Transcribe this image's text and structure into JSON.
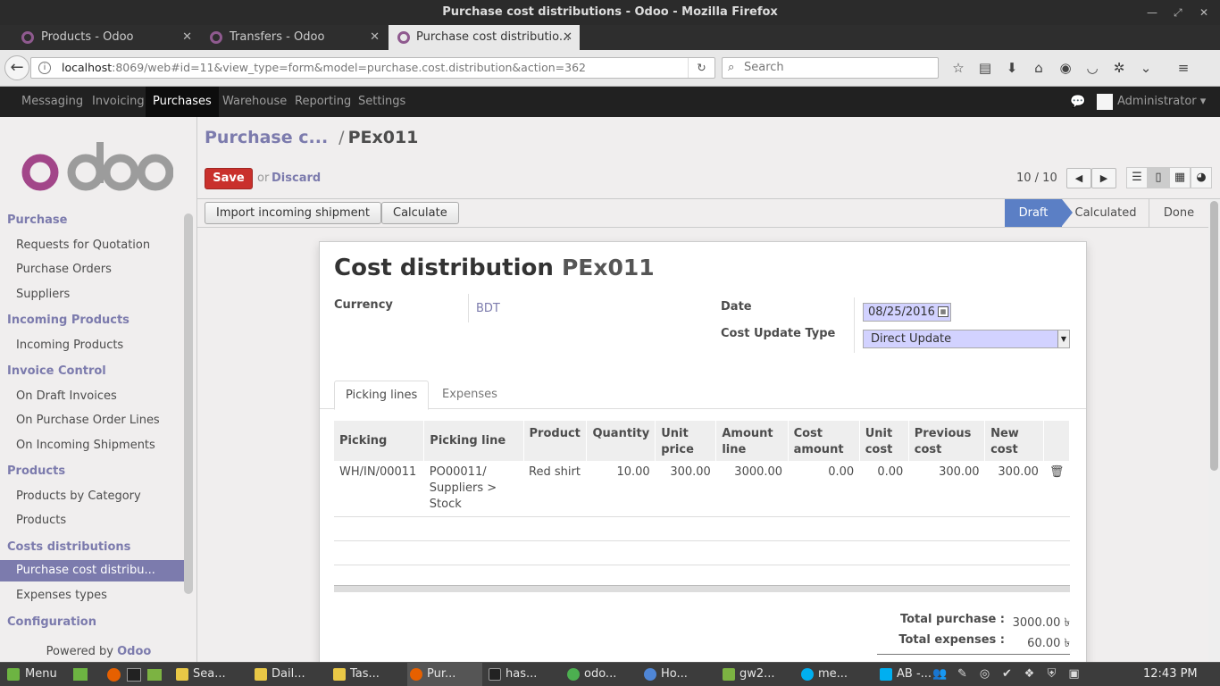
{
  "window": {
    "title": "Purchase cost distributions - Odoo - Mozilla Firefox"
  },
  "browser": {
    "tabs": [
      {
        "label": "Products - Odoo"
      },
      {
        "label": "Transfers - Odoo"
      },
      {
        "label": "Purchase cost distributio..."
      }
    ],
    "url_host": "localhost",
    "url_rest": ":8069/web#id=11&view_type=form&model=purchase.cost.distribution&action=362",
    "search_placeholder": "Search"
  },
  "topmenu": {
    "items": [
      "Messaging",
      "Invoicing",
      "Purchases",
      "Warehouse",
      "Reporting",
      "Settings"
    ],
    "active": "Purchases",
    "user": "Administrator"
  },
  "sidebar": {
    "sections": [
      {
        "title": "Purchase",
        "items": [
          "Requests for Quotation",
          "Purchase Orders",
          "Suppliers"
        ]
      },
      {
        "title": "Incoming Products",
        "items": [
          "Incoming Products"
        ]
      },
      {
        "title": "Invoice Control",
        "items": [
          "On Draft Invoices",
          "On Purchase Order Lines",
          "On Incoming Shipments"
        ]
      },
      {
        "title": "Products",
        "items": [
          "Products by Category",
          "Products"
        ]
      },
      {
        "title": "Costs distributions",
        "items": [
          "Purchase cost distribu...",
          "Expenses types"
        ]
      },
      {
        "title": "Configuration",
        "items": []
      }
    ],
    "powered_by": "Powered by",
    "powered_brand": "Odoo"
  },
  "control": {
    "breadcrumb_parent": "Purchase c...",
    "breadcrumb_sep": "/",
    "breadcrumb_current": "PEx011",
    "save_label": "Save",
    "or_label": "or",
    "discard_label": "Discard",
    "pager": "10 / 10"
  },
  "header": {
    "buttons": [
      "Import incoming shipment",
      "Calculate"
    ],
    "stages": [
      "Draft",
      "Calculated",
      "Done"
    ],
    "active_stage": "Draft"
  },
  "form": {
    "title": "Cost distribution",
    "ref": "PEx011",
    "currency_label": "Currency",
    "currency_value": "BDT",
    "date_label": "Date",
    "date_value": "08/25/2016",
    "cost_update_label": "Cost Update Type",
    "cost_update_value": "Direct Update",
    "tabs": [
      "Picking lines",
      "Expenses"
    ],
    "columns": [
      "Picking",
      "Picking line",
      "Product",
      "Quantity",
      "Unit price",
      "Amount line",
      "Cost amount",
      "Unit cost",
      "Previous cost",
      "New cost"
    ],
    "rows": [
      {
        "picking": "WH/IN/00011",
        "picking_line": "PO00011/ Suppliers > Stock",
        "product": "Red shirt",
        "quantity": "10.00",
        "unit_price": "300.00",
        "amount_line": "3000.00",
        "cost_amount": "0.00",
        "unit_cost": "0.00",
        "previous_cost": "300.00",
        "new_cost": "300.00"
      }
    ],
    "total_purchase_label": "Total purchase :",
    "total_purchase_value": "3000.00 ৳",
    "total_expenses_label": "Total expenses :",
    "total_expenses_value": "60.00 ৳"
  },
  "taskbar": {
    "menu_label": "Menu",
    "items": [
      "Sea...",
      "Dail...",
      "Tas...",
      "Pur...",
      "has...",
      "odo...",
      "Ho...",
      "gw2...",
      "me...",
      "AB -..."
    ],
    "clock": "12:43 PM"
  },
  "colors": {
    "brand": "#7c7bad",
    "save": "#c9302c",
    "stage_active": "#5b7fc5",
    "menubar": "#212121"
  }
}
